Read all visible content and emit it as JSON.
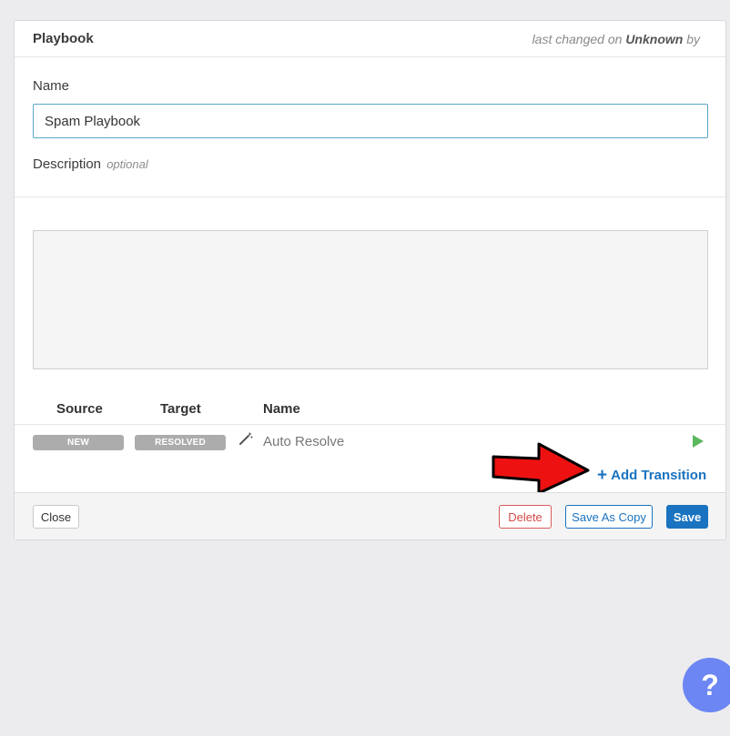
{
  "panel": {
    "title": "Playbook",
    "last_changed_prefix": "last changed on",
    "last_changed_value": "Unknown",
    "last_changed_suffix": "by"
  },
  "form": {
    "name_label": "Name",
    "name_value": "Spam Playbook",
    "description_label": "Description",
    "description_optional": "optional"
  },
  "transitions": {
    "headers": {
      "source": "Source",
      "target": "Target",
      "name": "Name"
    },
    "rows": [
      {
        "source": "NEW",
        "target": "RESOLVED",
        "name": "Auto Resolve"
      }
    ],
    "add_label": "Add Transition"
  },
  "footer": {
    "close_label": "Close",
    "delete_label": "Delete",
    "save_as_copy_label": "Save As Copy",
    "save_label": "Save"
  },
  "help_button": {
    "label": "?"
  },
  "colors": {
    "accent": "#1a73c0",
    "danger": "#d44a4a",
    "play_green": "#5cb85c",
    "annotation_arrow": "#ee1111",
    "help_bubble": "#6c86f3",
    "state_pill": "#acacac"
  }
}
